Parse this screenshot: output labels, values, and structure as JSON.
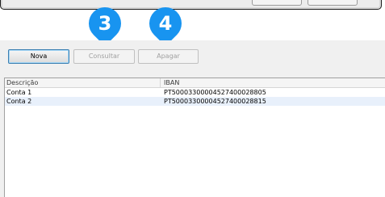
{
  "badges": {
    "three": "3",
    "four": "4"
  },
  "toolbar": {
    "nova_label": "Nova",
    "consultar_label": "Consultar",
    "apagar_label": "Apagar"
  },
  "table": {
    "headers": [
      "Descrição",
      "IBAN"
    ],
    "rows": [
      {
        "descricao": "Conta 1",
        "iban": "PT50003300004527400028805"
      },
      {
        "descricao": "Conta 2",
        "iban": "PT50003300004527400028815"
      }
    ]
  },
  "colors": {
    "badge": "#1894f0",
    "selected_row": "#e8f0fb"
  }
}
